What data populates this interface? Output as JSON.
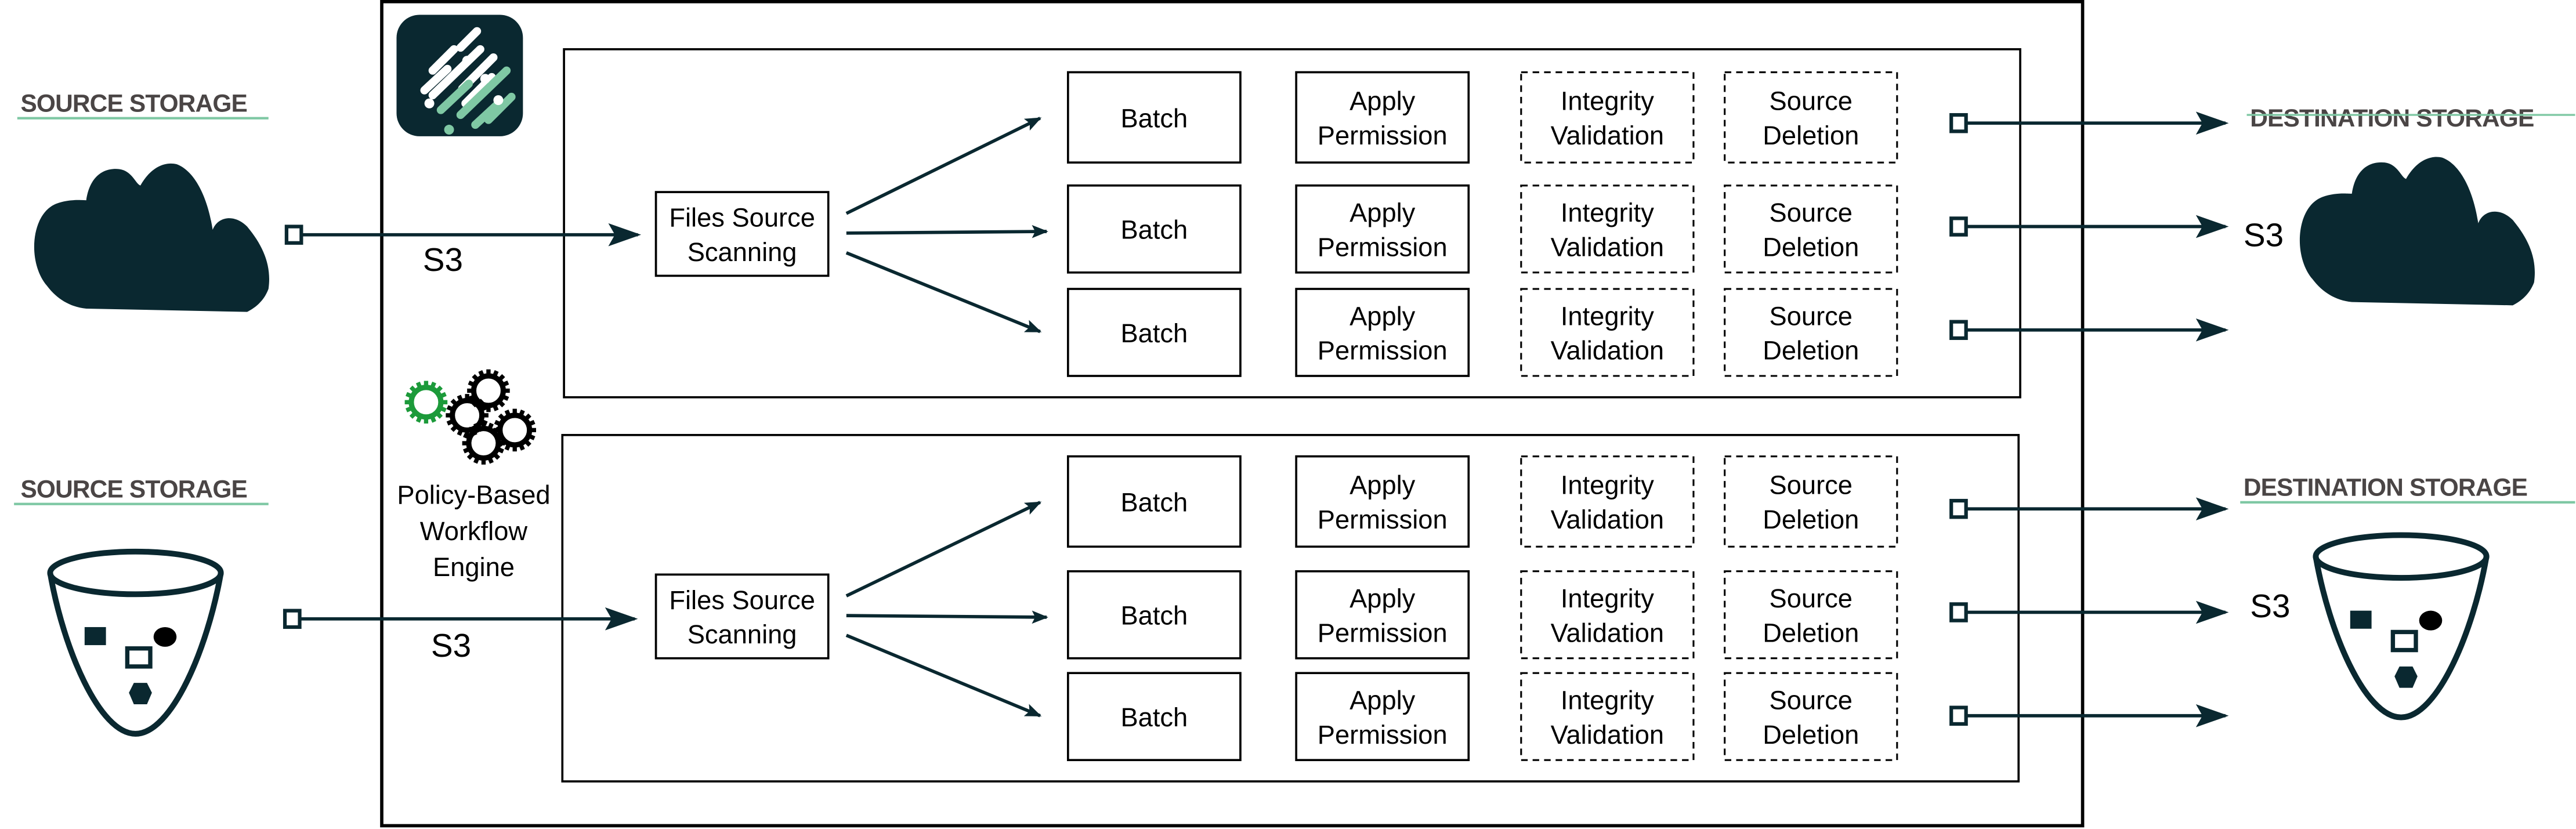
{
  "colors": {
    "dark": "#0a2830",
    "accent": "#7fc8a4",
    "gear_green": "#1c9a3a",
    "label": "#4a4545"
  },
  "source": [
    {
      "label": "SOURCE STORAGE",
      "protocol": "S3",
      "icon": "cloud-icon"
    },
    {
      "label": "SOURCE STORAGE",
      "protocol": "S3",
      "icon": "bucket-icon"
    }
  ],
  "destination": [
    {
      "label": "DESTINATION STORAGE",
      "protocol": "S3",
      "icon": "cloud-icon"
    },
    {
      "label": "DESTINATION STORAGE",
      "protocol": "S3",
      "icon": "bucket-icon"
    }
  ],
  "engine": {
    "lines": [
      "Policy-Based",
      "Workflow",
      "Engine"
    ],
    "icon": "gears-icon",
    "logo": "logo-icon"
  },
  "scanning": {
    "lines": [
      "Files Source",
      "Scanning"
    ]
  },
  "steps": {
    "batch": "Batch",
    "apply": [
      "Apply",
      "Permission"
    ],
    "integrity": [
      "Integrity",
      "Validation"
    ],
    "deletion": [
      "Source",
      "Deletion"
    ]
  }
}
